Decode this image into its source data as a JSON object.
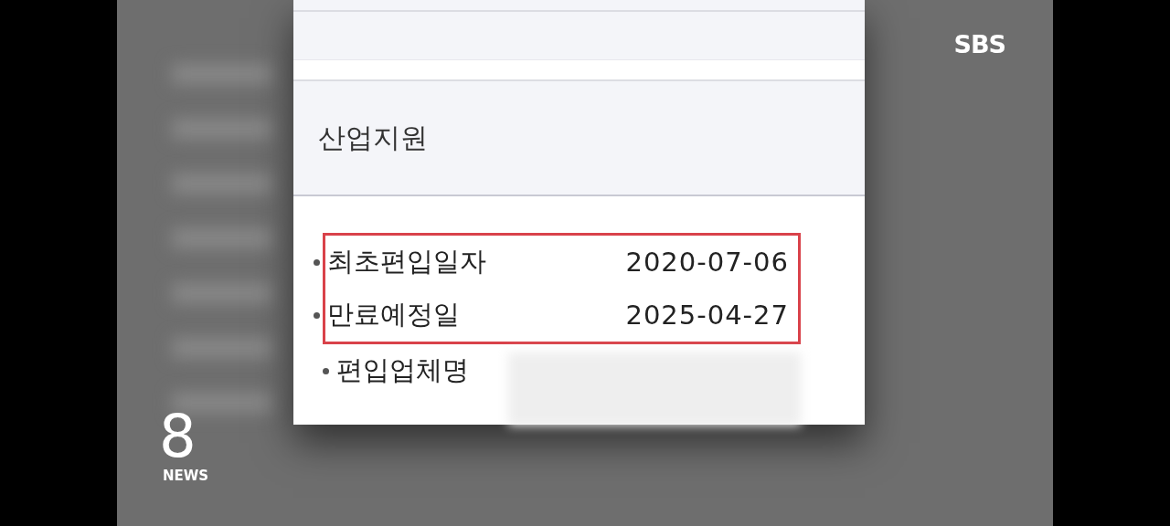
{
  "section": {
    "title": "산업지원"
  },
  "items": [
    {
      "label": "최초편입일자",
      "value": "2020-07-06",
      "highlighted": true,
      "redacted": false
    },
    {
      "label": "만료예정일",
      "value": "2025-04-27",
      "highlighted": true,
      "redacted": false
    },
    {
      "label": "편입업체명",
      "highlighted": false,
      "redacted": true
    }
  ],
  "broadcast": {
    "channel": "SBS",
    "program_number": "8",
    "program_name": "NEWS"
  }
}
